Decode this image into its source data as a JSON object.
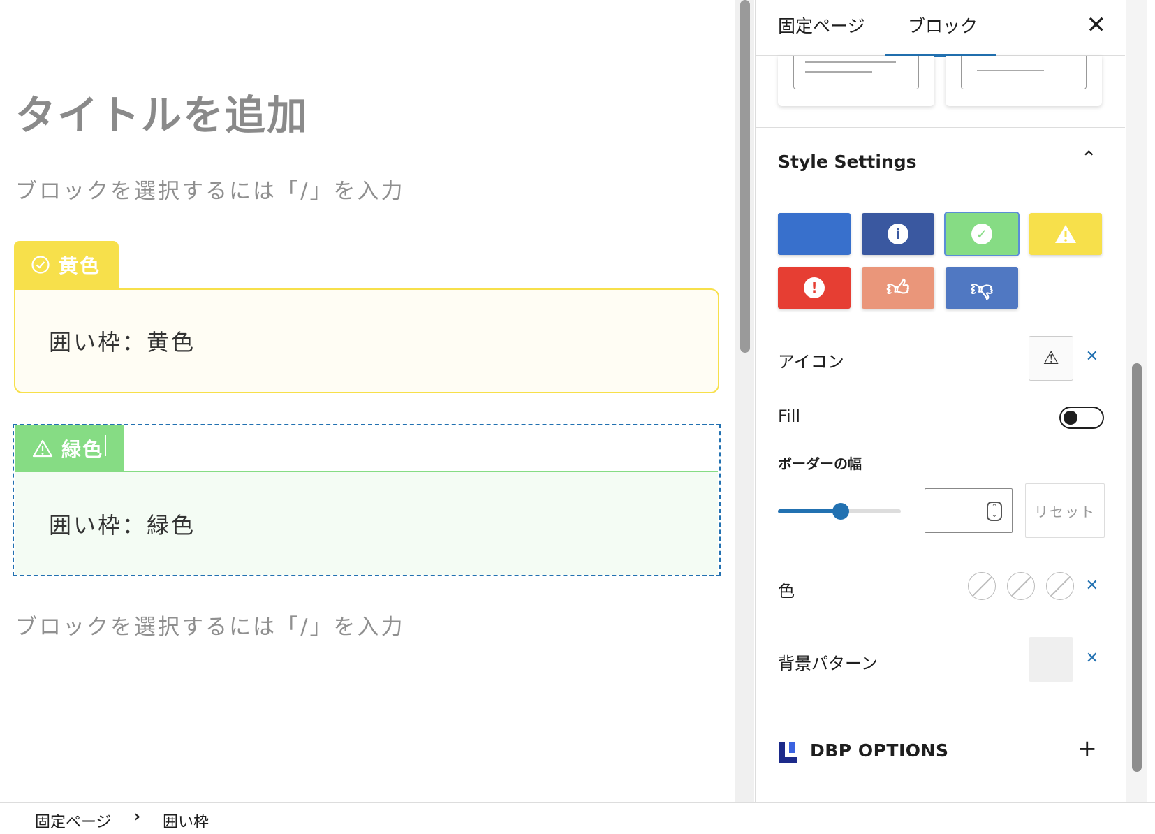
{
  "editor": {
    "title_placeholder": "タイトルを追加",
    "block_placeholder_1": "ブロックを選択するには「/」を入力",
    "block_placeholder_2": "ブロックを選択するには「/」を入力",
    "boxes": [
      {
        "tab_label": "黄色",
        "tab_icon": "check-circle-icon",
        "content": "囲い枠：黄色",
        "color": "#f7e04b"
      },
      {
        "tab_label": "緑色",
        "tab_icon": "warning-icon",
        "content": "囲い枠：緑色",
        "color": "#86dc84"
      }
    ]
  },
  "sidebar": {
    "tabs": [
      "固定ページ",
      "ブロック"
    ],
    "active_tab": "ブロック",
    "close_icon": "close-icon",
    "style_settings": {
      "title": "Style Settings",
      "swatches": [
        {
          "color": "#3870cc",
          "icon": ""
        },
        {
          "color": "#3a58a0",
          "icon": "info-icon"
        },
        {
          "color": "#86dc84",
          "icon": "check-icon",
          "selected": true
        },
        {
          "color": "#f7e04b",
          "icon": "warning-icon"
        },
        {
          "color": "#e63e33",
          "icon": "exclamation-icon"
        },
        {
          "color": "#ea967a",
          "icon": "thumbs-up-icon"
        },
        {
          "color": "#5078c2",
          "icon": "thumbs-down-icon"
        }
      ],
      "icon_label": "アイコン",
      "icon_value": "⚠",
      "fill_label": "Fill",
      "fill_on": false,
      "border_width_label": "ボーダーの幅",
      "border_width_value": "",
      "reset_label": "リセット",
      "color_label": "色",
      "bg_pattern_label": "背景パターン"
    },
    "dbp_options": {
      "title": "DBP OPTIONS"
    }
  },
  "footer": {
    "breadcrumb": [
      "固定ページ",
      "囲い枠"
    ]
  }
}
